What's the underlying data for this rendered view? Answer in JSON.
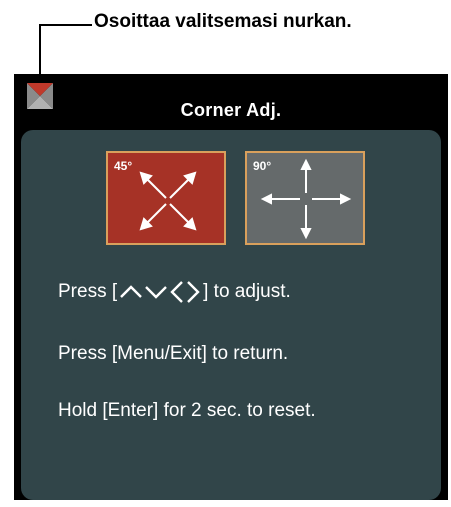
{
  "callout": {
    "text": "Osoittaa valitsemasi nurkan."
  },
  "osd": {
    "title": "Corner Adj.",
    "modes": [
      {
        "label": "45°",
        "selected": true,
        "color": "#a63226"
      },
      {
        "label": "90°",
        "selected": false,
        "color": "#656a6b"
      }
    ],
    "instructions": {
      "adjust_prefix": "Press [",
      "adjust_suffix": "] to adjust.",
      "return": "Press [Menu/Exit] to return.",
      "reset": "Hold [Enter] for 2 sec. to reset."
    }
  },
  "colors": {
    "panel": "#314549",
    "frame": "#000000",
    "border_accent": "#d9a05c",
    "selected_corner": "#c0392b"
  }
}
